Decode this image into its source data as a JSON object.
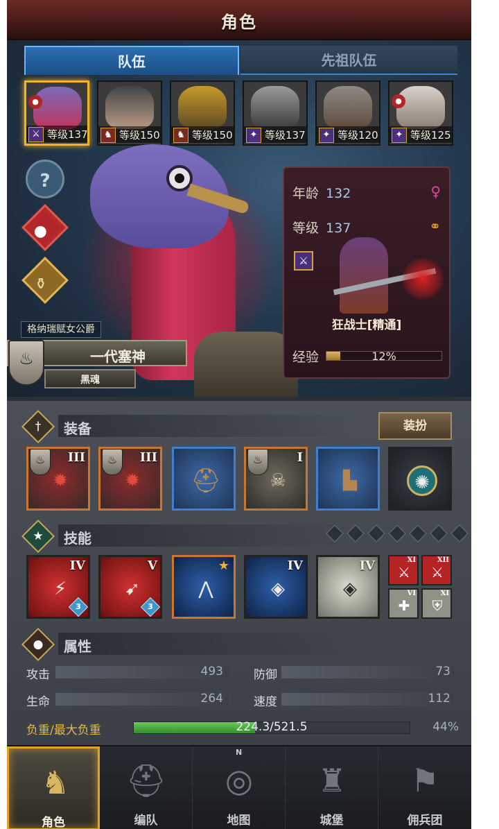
{
  "header": {
    "title": "角色"
  },
  "tabs": [
    {
      "label": "队伍",
      "active": true
    },
    {
      "label": "先祖队伍",
      "active": false
    }
  ],
  "roster": [
    {
      "level_label": "等级137",
      "class_icon": "sword-icon",
      "selected": true
    },
    {
      "level_label": "等级150",
      "class_icon": "horse-icon",
      "selected": false
    },
    {
      "level_label": "等级150",
      "class_icon": "horse-icon",
      "selected": false
    },
    {
      "level_label": "等级137",
      "class_icon": "staff-icon",
      "selected": false
    },
    {
      "level_label": "等级120",
      "class_icon": "staff-icon",
      "selected": false
    },
    {
      "level_label": "等级125",
      "class_icon": "staff-icon",
      "selected": false
    }
  ],
  "hero": {
    "title_badge": "格纳瑞赋女公爵",
    "name": "一代塞神",
    "soul": "黑魂"
  },
  "info": {
    "age_label": "年龄",
    "age": "132",
    "level_label": "等级",
    "level": "137",
    "gender_icon": "female-icon",
    "marriage_icon": "rings-icon",
    "class_name": "狂战士[精通]",
    "exp_label": "经验",
    "exp_text": "12%",
    "exp_percent": 12
  },
  "equipment": {
    "label": "装备",
    "dress_button": "装扮",
    "slots": [
      {
        "tier": "III",
        "icon": "weapon-icon"
      },
      {
        "tier": "III",
        "icon": "weapon-icon"
      },
      {
        "tier": "",
        "icon": "helmet-icon"
      },
      {
        "tier": "I",
        "icon": "armor-icon"
      },
      {
        "tier": "",
        "icon": "boots-icon"
      },
      {
        "tier": "",
        "icon": "amulet-icon"
      }
    ]
  },
  "skills": {
    "label": "技能",
    "pip_count": 7,
    "slots": [
      {
        "tier": "IV",
        "sub": "3"
      },
      {
        "tier": "V",
        "sub": "3"
      },
      {
        "tier": "",
        "star": true
      },
      {
        "tier": "IV"
      },
      {
        "tier": "IV"
      }
    ],
    "minis": [
      "XI",
      "XII",
      "VI",
      "XI"
    ]
  },
  "attributes": {
    "label": "属性",
    "attack_label": "攻击",
    "attack": "493",
    "defense_label": "防御",
    "defense": "73",
    "hp_label": "生命",
    "hp": "264",
    "speed_label": "速度",
    "speed": "112",
    "load_label": "负重/最大负重",
    "load_text": "224.3/521.5",
    "load_percent_text": "44%",
    "load_fraction": 0.44
  },
  "nav": [
    {
      "label": "角色",
      "active": true
    },
    {
      "label": "编队",
      "active": false
    },
    {
      "label": "地图",
      "active": false,
      "compass": "N"
    },
    {
      "label": "城堡",
      "active": false
    },
    {
      "label": "佣兵团",
      "active": false
    }
  ],
  "colors": {
    "accent_gold": "#f0b526",
    "tab_active": "#2c6fb2",
    "load_green": "#2f8e2c"
  }
}
